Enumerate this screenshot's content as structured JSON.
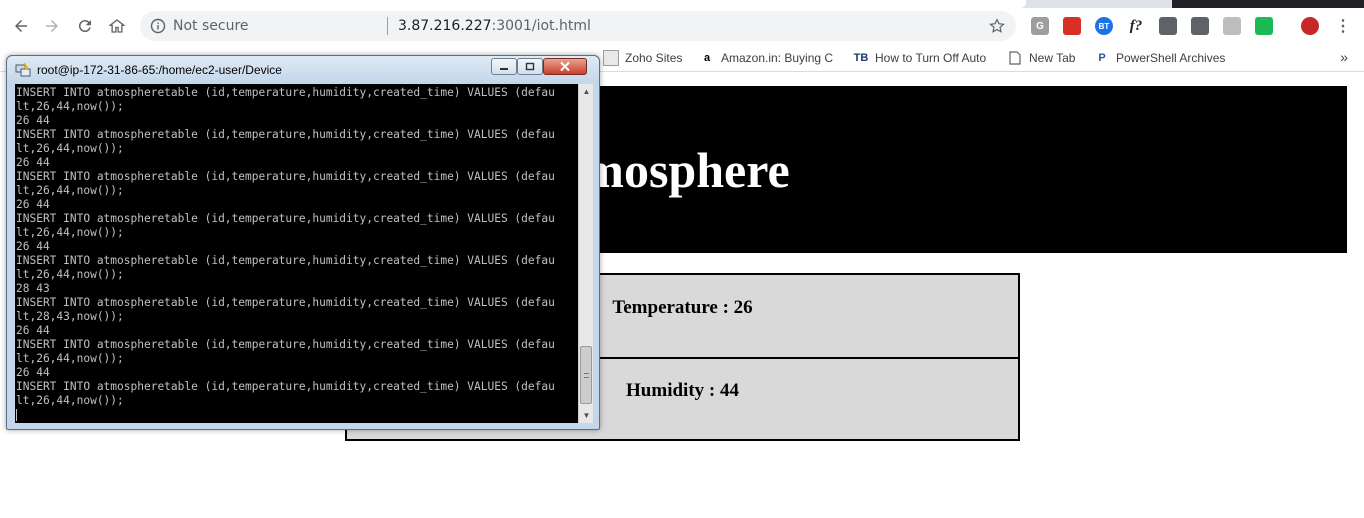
{
  "browser": {
    "address": {
      "security_label": "Not secure",
      "url_host": "3.87.216.227",
      "url_rest": ":3001/iot.html"
    },
    "bookmarks": [
      {
        "label": "Zoho Sites",
        "icon": "zoho-icon"
      },
      {
        "label": "Amazon.in: Buying C",
        "icon": "amazon-icon"
      },
      {
        "label": "How to Turn Off Auto",
        "icon": "tb-icon"
      },
      {
        "label": "New Tab",
        "icon": "page-icon"
      },
      {
        "label": "PowerShell Archives",
        "icon": "powershell-icon"
      }
    ],
    "bookmarks_more": "»",
    "extensions": [
      {
        "name": "grammarly-icon",
        "glyph": "G",
        "color": "#9e9e9e"
      },
      {
        "name": "book-extension-icon",
        "glyph": "",
        "color": "#d93025"
      },
      {
        "name": "bt-extension-icon",
        "glyph": "BT",
        "color": "#1a73e8"
      },
      {
        "name": "function-extension-icon",
        "glyph": "f?",
        "color": "#ffffff"
      },
      {
        "name": "qr-extension-icon",
        "glyph": "",
        "color": "#5f6368"
      },
      {
        "name": "shield-extension-icon",
        "glyph": "",
        "color": "#5f6368"
      },
      {
        "name": "tab-extension-icon",
        "glyph": "",
        "color": "#bdbdbd"
      },
      {
        "name": "vpn-extension-icon",
        "glyph": "",
        "color": "#1db954"
      }
    ]
  },
  "page": {
    "title_visible": "mosphere",
    "temperature_label": "Temperature : 26",
    "humidity_label": "Humidity : 44"
  },
  "terminal": {
    "title": "root@ip-172-31-86-65:/home/ec2-user/Device",
    "lines": [
      "INSERT INTO atmospheretable (id,temperature,humidity,created_time) VALUES (defau",
      "lt,26,44,now());",
      "26 44",
      "INSERT INTO atmospheretable (id,temperature,humidity,created_time) VALUES (defau",
      "lt,26,44,now());",
      "26 44",
      "INSERT INTO atmospheretable (id,temperature,humidity,created_time) VALUES (defau",
      "lt,26,44,now());",
      "26 44",
      "INSERT INTO atmospheretable (id,temperature,humidity,created_time) VALUES (defau",
      "lt,26,44,now());",
      "26 44",
      "INSERT INTO atmospheretable (id,temperature,humidity,created_time) VALUES (defau",
      "lt,26,44,now());",
      "28 43",
      "INSERT INTO atmospheretable (id,temperature,humidity,created_time) VALUES (defau",
      "lt,28,43,now());",
      "26 44",
      "INSERT INTO atmospheretable (id,temperature,humidity,created_time) VALUES (defau",
      "lt,26,44,now());",
      "26 44",
      "INSERT INTO atmospheretable (id,temperature,humidity,created_time) VALUES (defau",
      "lt,26,44,now());"
    ]
  }
}
